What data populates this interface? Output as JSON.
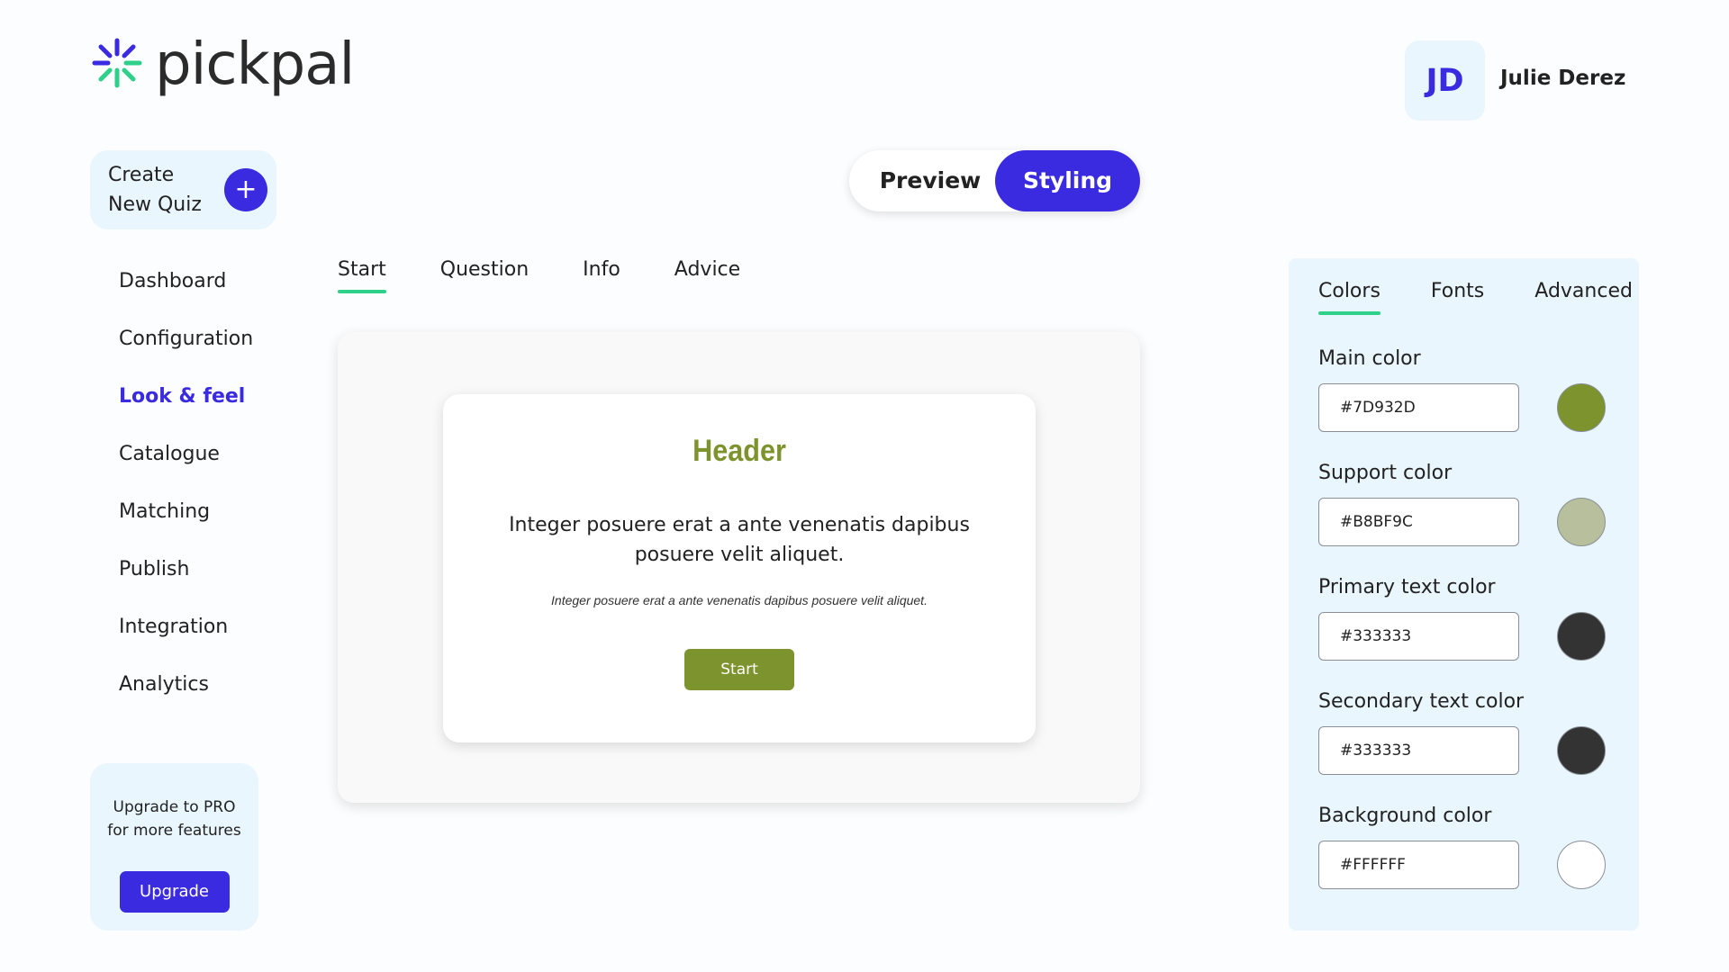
{
  "brand": {
    "name": "pickpal",
    "icon": "sparkle-logo-icon"
  },
  "create": {
    "label_line1": "Create",
    "label_line2": "New Quiz",
    "plus": "+"
  },
  "sidebar": {
    "items": [
      {
        "label": "Dashboard"
      },
      {
        "label": "Configuration"
      },
      {
        "label": "Look & feel",
        "active": true
      },
      {
        "label": "Catalogue"
      },
      {
        "label": "Matching"
      },
      {
        "label": "Publish"
      },
      {
        "label": "Integration"
      },
      {
        "label": "Analytics"
      }
    ]
  },
  "upgrade": {
    "line1": "Upgrade to PRO",
    "line2": "for more features",
    "button": "Upgrade"
  },
  "toggle": {
    "preview": "Preview",
    "styling": "Styling",
    "active": "Styling"
  },
  "user": {
    "initials": "JD",
    "name": "Julie Derez"
  },
  "content_tabs": [
    {
      "label": "Start",
      "active": true
    },
    {
      "label": "Question"
    },
    {
      "label": "Info"
    },
    {
      "label": "Advice"
    }
  ],
  "quiz_preview": {
    "header": "Header",
    "body": "Integer posuere erat a ante venenatis dapibus posuere velit aliquet.",
    "small": "Integer posuere erat a ante venenatis dapibus posuere velit aliquet.",
    "start_button": "Start"
  },
  "styling_panel": {
    "tabs": [
      {
        "label": "Colors",
        "active": true
      },
      {
        "label": "Fonts"
      },
      {
        "label": "Advanced"
      }
    ],
    "colors": [
      {
        "label": "Main color",
        "value": "#7D932D",
        "swatch": "#7d932d"
      },
      {
        "label": "Support color",
        "value": "#B8BF9C",
        "swatch": "#b8bf9c"
      },
      {
        "label": "Primary text color",
        "value": "#333333",
        "swatch": "#333333"
      },
      {
        "label": "Secondary text color",
        "value": "#333333",
        "swatch": "#333333"
      },
      {
        "label": "Background color",
        "value": "#FFFFFF",
        "swatch": "#ffffff"
      }
    ]
  },
  "theme": {
    "accent": "#3a2ae0",
    "green": "#2fd08a",
    "panel_bg": "#e9f6fd"
  }
}
